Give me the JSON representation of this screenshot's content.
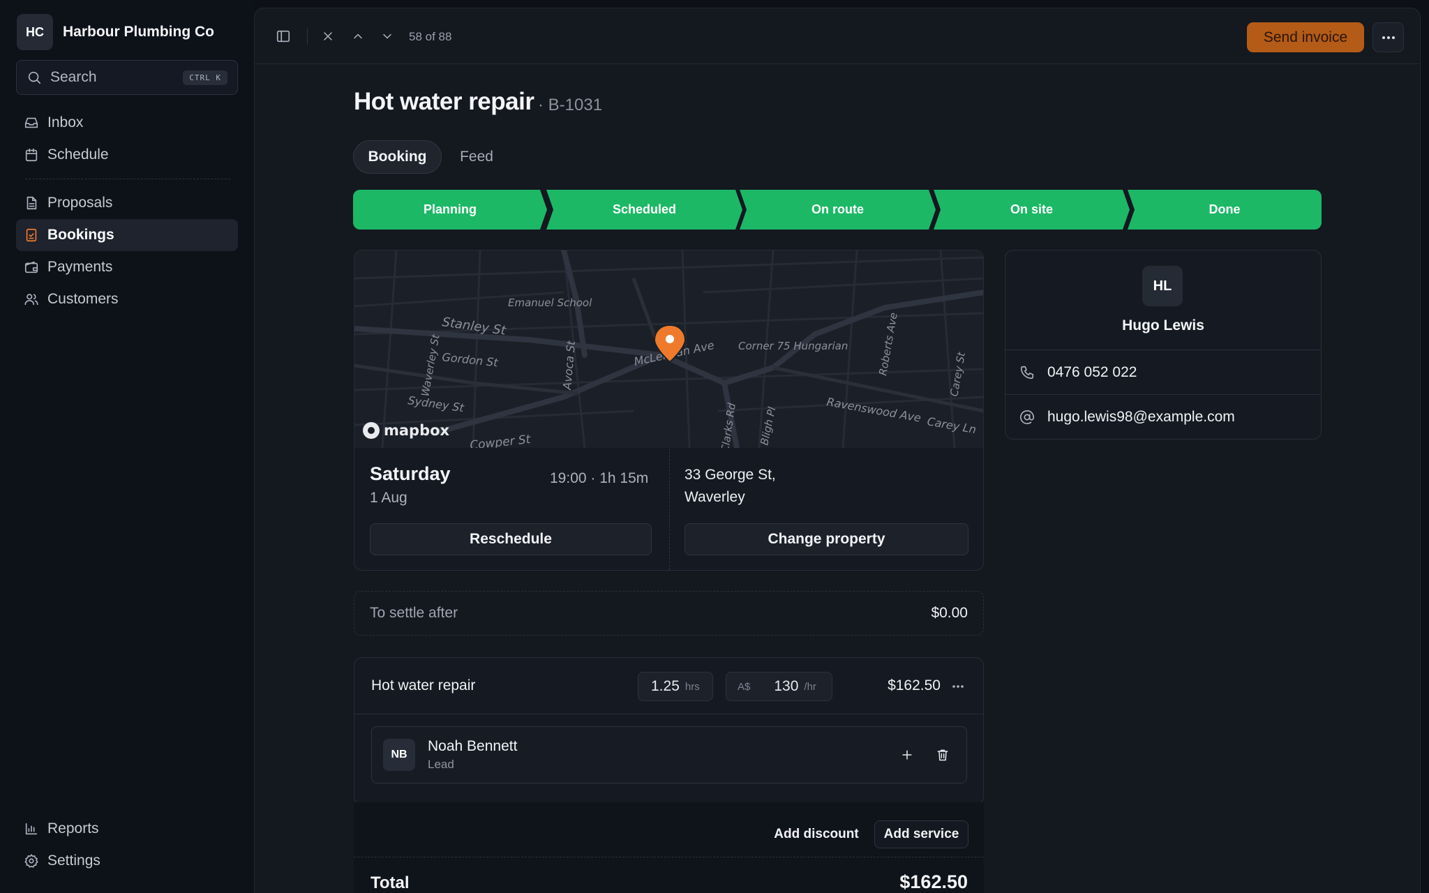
{
  "sidebar": {
    "brand_initials": "HC",
    "brand_name": "Harbour Plumbing Co",
    "search": {
      "label": "Search",
      "shortcut": "CTRL K"
    },
    "items": [
      {
        "label": "Inbox",
        "icon": "inbox-icon"
      },
      {
        "label": "Schedule",
        "icon": "calendar-icon"
      },
      {
        "label": "Proposals",
        "icon": "document-icon"
      },
      {
        "label": "Bookings",
        "icon": "checklist-icon",
        "active": true
      },
      {
        "label": "Payments",
        "icon": "wallet-icon"
      },
      {
        "label": "Customers",
        "icon": "users-icon"
      }
    ],
    "footer": [
      {
        "label": "Reports",
        "icon": "bar-chart-icon"
      },
      {
        "label": "Settings",
        "icon": "gear-icon"
      }
    ]
  },
  "topbar": {
    "counter": "58 of 88",
    "send_invoice": "Send invoice"
  },
  "booking": {
    "title": "Hot water repair",
    "id_label": "· B-1031",
    "tabs": [
      {
        "label": "Booking",
        "active": true
      },
      {
        "label": "Feed",
        "active": false
      }
    ],
    "stages": [
      "Planning",
      "Scheduled",
      "On route",
      "On site",
      "Done"
    ],
    "stage_color": "#1cb866",
    "map": {
      "attribution": "mapbox",
      "labels": [
        "Emanuel School",
        "Stanley St",
        "Gordon St",
        "Waverley St",
        "Avoca St",
        "McLennan Ave",
        "Corner 75 Hungarian",
        "Roberts Ave",
        "Carey St",
        "Sydney St",
        "Ravenswood Ave",
        "Carey Ln",
        "Cowper St",
        "Bligh Pl",
        "Clarks Rd"
      ],
      "pin_color": "#f07a2c"
    },
    "when": {
      "day": "Saturday",
      "date": "1 Aug",
      "time": "19:00 · 1h 15m"
    },
    "address": {
      "line1": "33 George St,",
      "line2": "Waverley"
    },
    "reschedule": "Reschedule",
    "change_property": "Change property",
    "settle": {
      "label": "To settle after",
      "amount": "$0.00"
    },
    "service": {
      "name": "Hot water repair",
      "hours": "1.25",
      "hours_unit": "hrs",
      "currency": "A$",
      "rate": "130",
      "rate_unit": "/hr",
      "amount": "$162.50",
      "worker": {
        "initials": "NB",
        "name": "Noah Bennett",
        "role": "Lead"
      }
    },
    "add_discount": "Add discount",
    "add_service": "Add service",
    "total_label": "Total",
    "total": "$162.50"
  },
  "customer": {
    "initials": "HL",
    "name": "Hugo Lewis",
    "phone": "0476 052 022",
    "email": "hugo.lewis98@example.com"
  },
  "colors": {
    "accent": "#b45b17",
    "active_icon": "#f07a2c",
    "success": "#1cb866"
  }
}
